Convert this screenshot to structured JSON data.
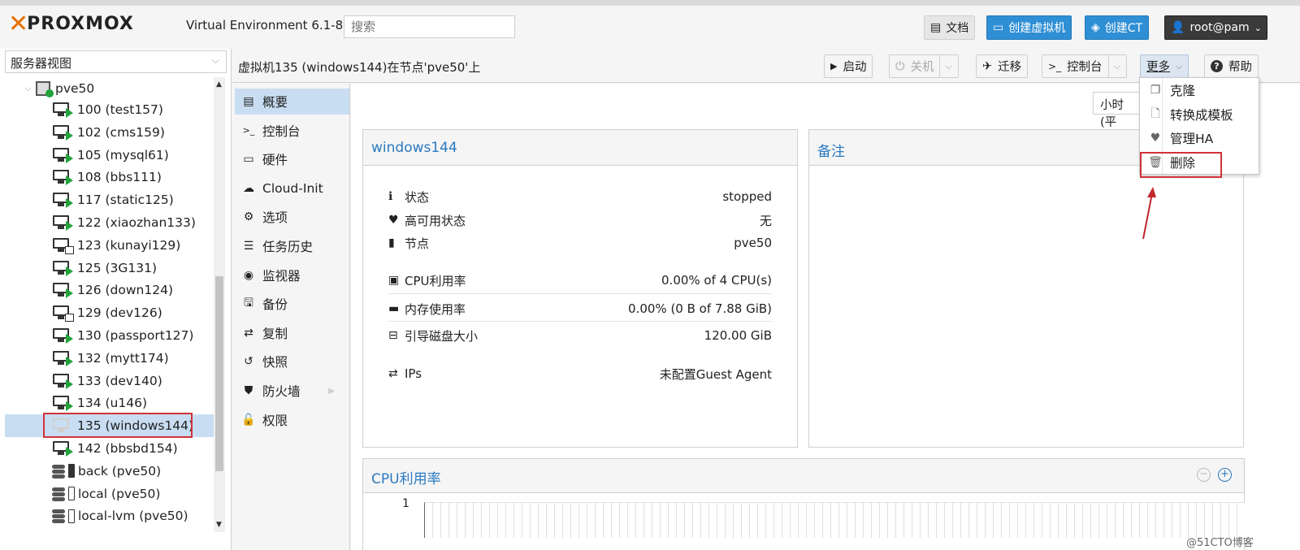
{
  "topbar": {
    "logo_text": "PROXMOX",
    "version": "Virtual Environment 6.1-8",
    "search_placeholder": "搜索",
    "docs": "文档",
    "create_vm": "创建虚拟机",
    "create_ct": "创建CT",
    "user": "root@pam"
  },
  "tree": {
    "view": "服务器视图",
    "node": "pve50",
    "items": [
      {
        "label": "100 (test157)",
        "kind": "running"
      },
      {
        "label": "102 (cms159)",
        "kind": "running"
      },
      {
        "label": "105 (mysql61)",
        "kind": "running"
      },
      {
        "label": "108 (bbs111)",
        "kind": "running"
      },
      {
        "label": "117 (static125)",
        "kind": "running"
      },
      {
        "label": "122 (xiaozhan133)",
        "kind": "running"
      },
      {
        "label": "123 (kunayi129)",
        "kind": "template"
      },
      {
        "label": "125 (3G131)",
        "kind": "running"
      },
      {
        "label": "126 (down124)",
        "kind": "running"
      },
      {
        "label": "129 (dev126)",
        "kind": "template"
      },
      {
        "label": "130 (passport127)",
        "kind": "running"
      },
      {
        "label": "132 (mytt174)",
        "kind": "running"
      },
      {
        "label": "133 (dev140)",
        "kind": "running"
      },
      {
        "label": "134 (u146)",
        "kind": "running"
      },
      {
        "label": "135 (windows144)",
        "kind": "stopped"
      },
      {
        "label": "142 (bbsbd154)",
        "kind": "running"
      },
      {
        "label": "back (pve50)",
        "kind": "storage"
      },
      {
        "label": "local (pve50)",
        "kind": "storage"
      },
      {
        "label": "local-lvm (pve50)",
        "kind": "storage"
      }
    ]
  },
  "header": {
    "title": "虚拟机135 (windows144)在节点'pve50'上",
    "start": "启动",
    "shutdown": "关机",
    "migrate": "迁移",
    "console": "控制台",
    "more": "更多",
    "help": "帮助"
  },
  "more_menu": [
    "克隆",
    "转换成模板",
    "管理HA",
    "删除"
  ],
  "nav": [
    "概要",
    "控制台",
    "硬件",
    "Cloud-Init",
    "选项",
    "任务历史",
    "监视器",
    "备份",
    "复制",
    "快照",
    "防火墙",
    "权限"
  ],
  "time_select": "小时 (平",
  "summary": {
    "title": "windows144",
    "rows": [
      {
        "label": "状态",
        "value": "stopped"
      },
      {
        "label": "高可用状态",
        "value": "无"
      },
      {
        "label": "节点",
        "value": "pve50"
      },
      {
        "label": "CPU利用率",
        "value": "0.00% of 4 CPU(s)"
      },
      {
        "label": "内存使用率",
        "value": "0.00% (0 B of 7.88 GiB)"
      },
      {
        "label": "引导磁盘大小",
        "value": "120.00 GiB"
      },
      {
        "label": "IPs",
        "value": "未配置Guest Agent"
      }
    ]
  },
  "notes_title": "备注",
  "cpu_panel": {
    "title": "CPU利用率",
    "y_tick": "1"
  },
  "watermark": "@51CTO博客",
  "colors": {
    "accent": "#2f8fd4",
    "brand_orange": "#e57000",
    "highlight": "#d0333a"
  }
}
